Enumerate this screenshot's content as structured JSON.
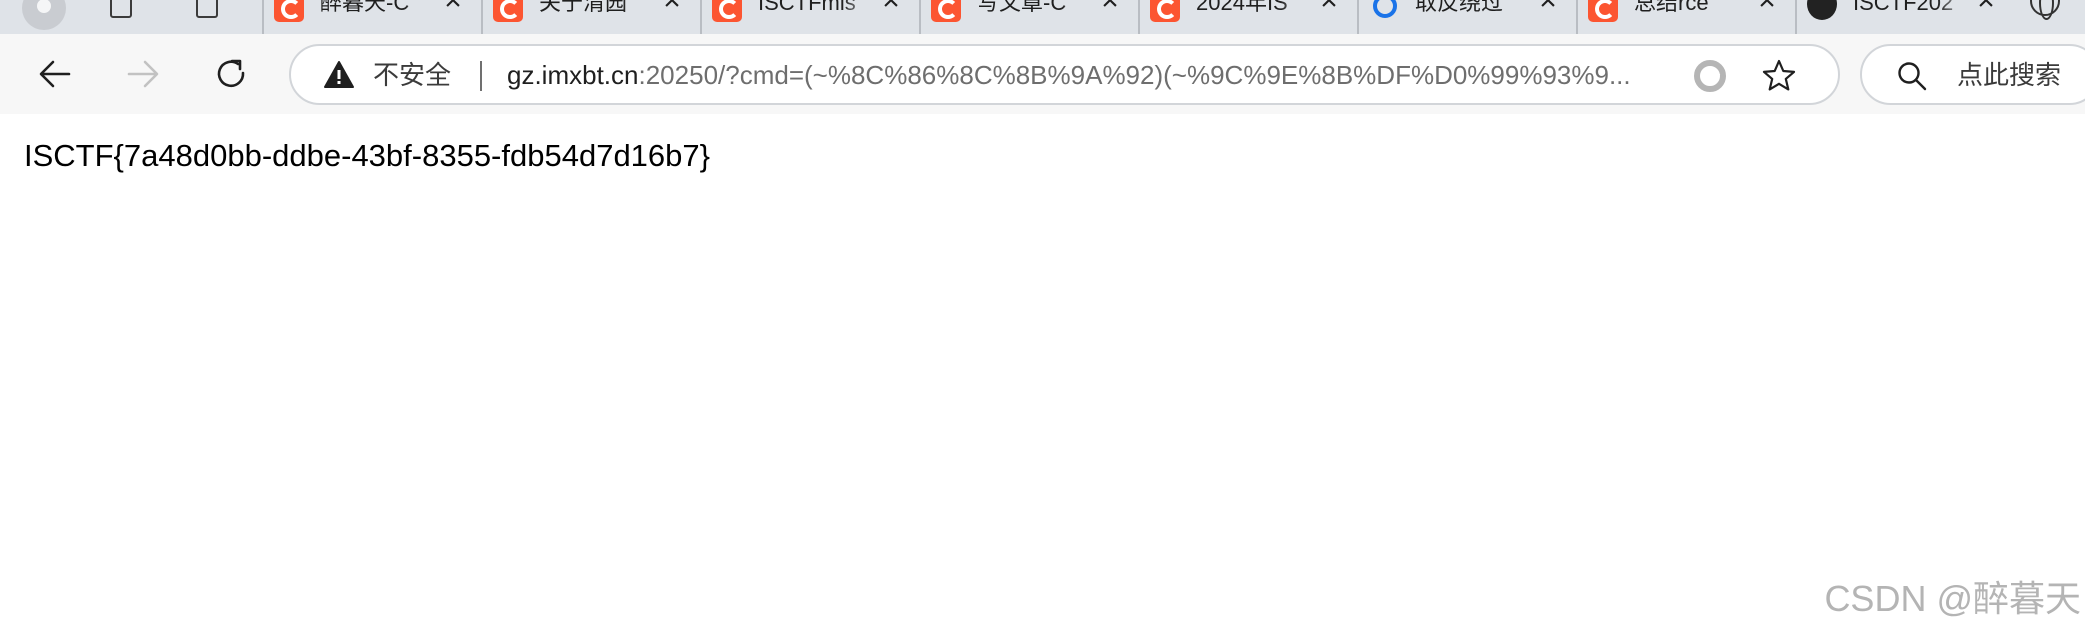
{
  "tabs": [
    {
      "title": "醉暮天-C",
      "icon": "csdn-icon"
    },
    {
      "title": "关于清园",
      "icon": "csdn-icon"
    },
    {
      "title": "ISCTFmis",
      "icon": "csdn-icon"
    },
    {
      "title": "写文章-C",
      "icon": "csdn-icon"
    },
    {
      "title": "2024年IS",
      "icon": "csdn-icon"
    },
    {
      "title": "取反绕过",
      "icon": "search-icon"
    },
    {
      "title": "总结rce",
      "icon": "csdn-icon"
    },
    {
      "title": "ISCTF202",
      "icon": "ctf-site-icon"
    }
  ],
  "toolbar": {
    "security_label": "不安全",
    "url_host": "gz.imxbt.cn",
    "url_rest": ":20250/?cmd=(~%8C%86%8C%8B%9A%92)(~%9C%9E%8B%DF%D0%99%93%9...",
    "search_placeholder": "点此搜索"
  },
  "page": {
    "content": "ISCTF{7a48d0bb-ddbe-43bf-8355-fdb54d7d16b7}",
    "watermark": "CSDN @醉暮天"
  },
  "colors": {
    "tab_strip": "#dfe3e8",
    "toolbar": "#f7f7f7",
    "csdn_brand": "#fc5531",
    "url_dim": "#6e6e6e"
  }
}
